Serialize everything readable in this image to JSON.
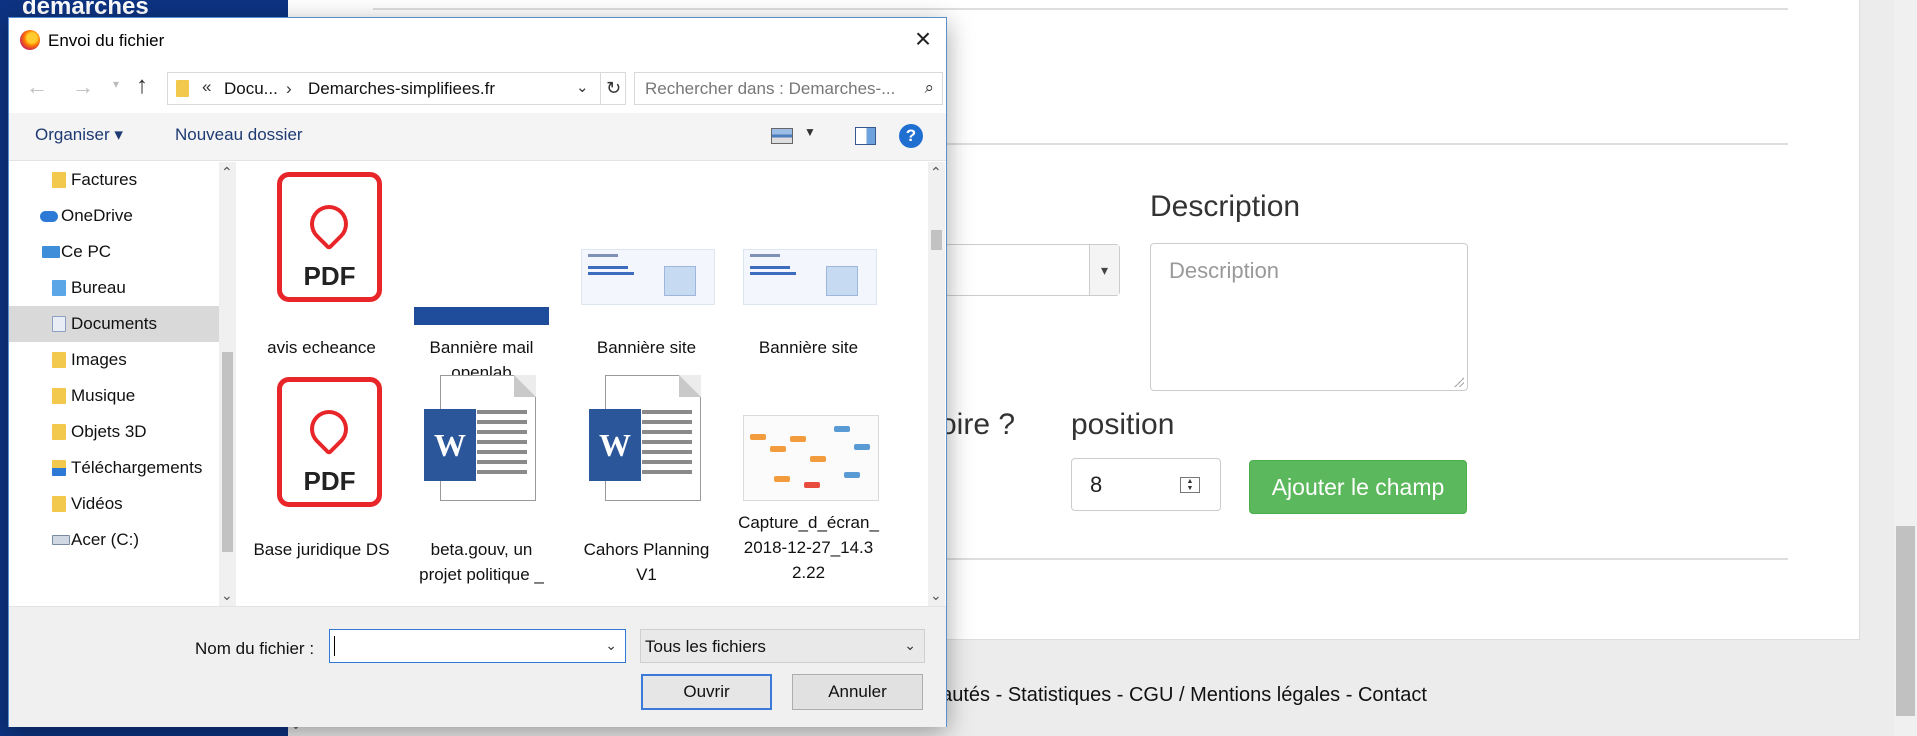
{
  "background": {
    "brand_text": "démarches\nsimplifiées.fr",
    "description_label": "Description",
    "description_placeholder": "Description",
    "obligatoire_label": "oire ?",
    "position_label": "position",
    "position_value": "8",
    "add_button": "Ajouter le champ",
    "footer_links": "eautés - Statistiques - CGU / Mentions légales - Contact"
  },
  "dialog": {
    "title": "Envoi du fichier",
    "address_parts": [
      "Docu...",
      "Demarches-simplifiees.fr"
    ],
    "search_placeholder": "Rechercher dans : Demarches-...",
    "toolbar": {
      "organise": "Organiser ▾",
      "new_folder": "Nouveau dossier"
    },
    "nav_items": [
      {
        "label": "Factures",
        "icon": "folder-icon"
      },
      {
        "label": "OneDrive",
        "icon": "cloud-icon"
      },
      {
        "label": "Ce PC",
        "icon": "pc-icon"
      },
      {
        "label": "Bureau",
        "icon": "desktop-folder-icon"
      },
      {
        "label": "Documents",
        "icon": "documents-folder-icon",
        "selected": true
      },
      {
        "label": "Images",
        "icon": "images-folder-icon"
      },
      {
        "label": "Musique",
        "icon": "music-folder-icon"
      },
      {
        "label": "Objets 3D",
        "icon": "objects3d-folder-icon"
      },
      {
        "label": "Téléchargements",
        "icon": "downloads-folder-icon"
      },
      {
        "label": "Vidéos",
        "icon": "videos-folder-icon"
      },
      {
        "label": "Acer (C:)",
        "icon": "drive-icon"
      }
    ],
    "files": [
      {
        "label_lines": [
          "avis echeance"
        ],
        "type": "pdf"
      },
      {
        "label_lines": [
          "Bannière mail",
          "openlab"
        ],
        "type": "banner"
      },
      {
        "label_lines": [
          "Bannière site"
        ],
        "type": "web"
      },
      {
        "label_lines": [
          "Bannière site"
        ],
        "type": "web"
      },
      {
        "label_lines": [
          "Base juridique DS"
        ],
        "type": "pdf"
      },
      {
        "label_lines": [
          "beta.gouv, un",
          "projet politique _"
        ],
        "type": "word"
      },
      {
        "label_lines": [
          "Cahors Planning",
          "V1"
        ],
        "type": "word"
      },
      {
        "label_lines": [
          "Capture_d_écran_",
          "2018-12-27_14.3",
          "2.22"
        ],
        "type": "image"
      }
    ],
    "pdf_text": "PDF",
    "word_letter": "W",
    "filename_label": "Nom du fichier :",
    "filename_value": "",
    "filter_value": "Tous les fichiers",
    "open_button": "Ouvrir",
    "cancel_button": "Annuler"
  }
}
